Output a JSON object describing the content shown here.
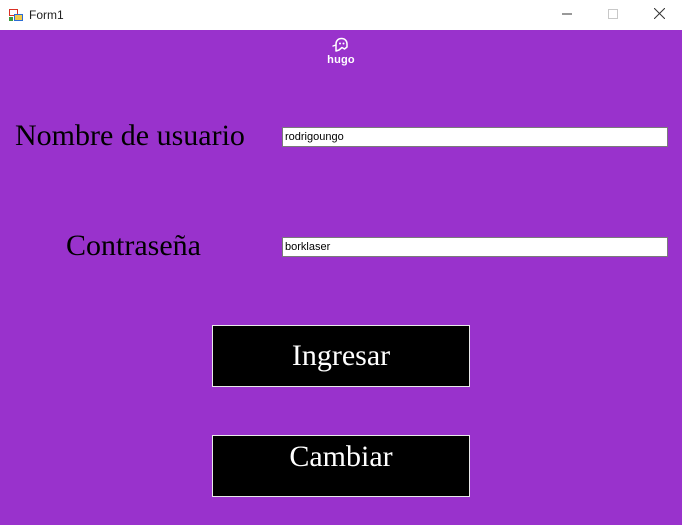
{
  "window": {
    "title": "Form1",
    "background": "#9932cc",
    "controls": {
      "minimize": "minimize-icon",
      "maximize": "maximize-icon",
      "close": "close-icon"
    }
  },
  "logo": {
    "icon": "ghost-icon",
    "text": "hugo"
  },
  "form": {
    "username_label": "Nombre de usuario",
    "username_value": "rodrigoungo",
    "password_label": "Contraseña",
    "password_value": "borklaser"
  },
  "buttons": {
    "ingresar": "Ingresar",
    "cambiar": "Cambiar"
  }
}
